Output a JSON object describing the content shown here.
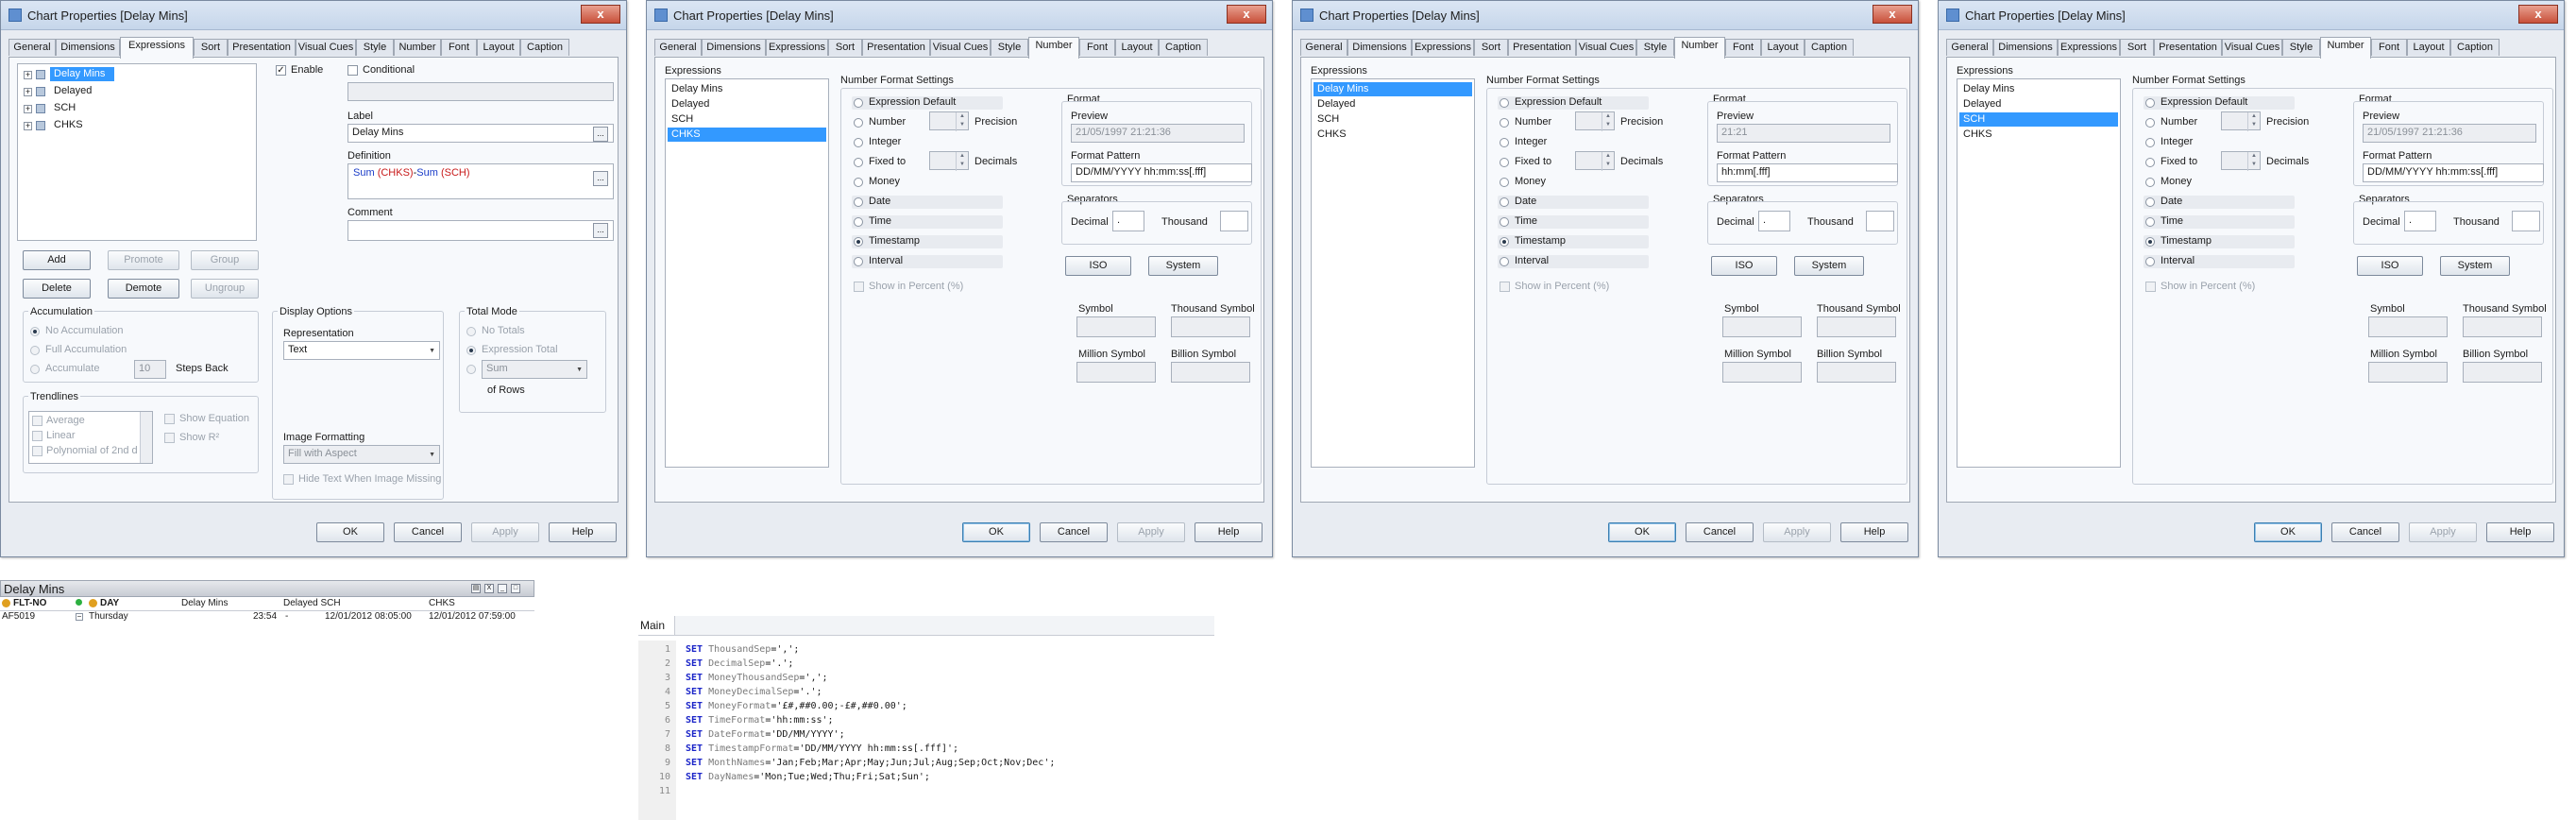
{
  "dialog_title": "Chart Properties [Delay Mins]",
  "close_glyph": "x",
  "tabs": [
    "General",
    "Dimensions",
    "Expressions",
    "Sort",
    "Presentation",
    "Visual Cues",
    "Style",
    "Number",
    "Font",
    "Layout",
    "Caption"
  ],
  "buttons": {
    "ok": "OK",
    "cancel": "Cancel",
    "apply": "Apply",
    "help": "Help"
  },
  "expressions_dialog": {
    "tree_items": [
      "Delay Mins",
      "Delayed",
      "SCH",
      "CHKS"
    ],
    "enable_label": "Enable",
    "conditional_label": "Conditional",
    "label_caption": "Label",
    "label_value": "Delay Mins",
    "definition_caption": "Definition",
    "definition_parts": {
      "f1": "Sum ",
      "a1": "(CHKS)",
      "m": "-",
      "f2": "Sum ",
      "a2": "(SCH)"
    },
    "comment_caption": "Comment",
    "btn_add": "Add",
    "btn_promote": "Promote",
    "btn_group": "Group",
    "btn_delete": "Delete",
    "btn_demote": "Demote",
    "btn_ungroup": "Ungroup",
    "accumulation": {
      "title": "Accumulation",
      "no": "No Accumulation",
      "full": "Full Accumulation",
      "acc": "Accumulate",
      "steps_value": "10",
      "steps_label": "Steps Back"
    },
    "trendlines": {
      "title": "Trendlines",
      "items": [
        "Average",
        "Linear",
        "Polynomial of 2nd d"
      ],
      "show_equation": "Show Equation",
      "show_r2": "Show R²"
    },
    "display_options": {
      "title": "Display Options",
      "representation_caption": "Representation",
      "representation_value": "Text",
      "image_caption": "Image Formatting",
      "image_value": "Fill with Aspect",
      "hide_text": "Hide Text When Image Missing"
    },
    "total_mode": {
      "title": "Total Mode",
      "no_totals": "No Totals",
      "expression_total": "Expression Total",
      "sum_value": "Sum",
      "of_rows": "of Rows"
    }
  },
  "number_dialog": {
    "expressions_caption": "Expressions",
    "items": [
      "Delay Mins",
      "Delayed",
      "SCH",
      "CHKS"
    ],
    "settings_caption": "Number Format Settings",
    "options": [
      "Expression Default",
      "Number",
      "Integer",
      "Fixed to",
      "Money",
      "Date",
      "Time",
      "Timestamp",
      "Interval"
    ],
    "precision_label": "Precision",
    "decimals_label": "Decimals",
    "show_percent": "Show in Percent (%)",
    "format_caption": "Format",
    "preview_caption": "Preview",
    "pattern_caption": "Format Pattern",
    "separators_caption": "Separators",
    "decimal_label": "Decimal",
    "thousand_label": "Thousand",
    "decimal_value": ".",
    "iso_label": "ISO",
    "system_label": "System",
    "symbol_label": "Symbol",
    "thousand_symbol_label": "Thousand Symbol",
    "million_symbol_label": "Million Symbol",
    "billion_symbol_label": "Billion Symbol",
    "dialogs": [
      {
        "selected": "CHKS",
        "preview": "21/05/1997 21:21:36",
        "pattern": "DD/MM/YYYY hh:mm:ss[.fff]"
      },
      {
        "selected": "Delay Mins",
        "preview": "21:21",
        "pattern": "hh:mm[.fff]"
      },
      {
        "selected": "SCH",
        "preview": "21/05/1997 21:21:36",
        "pattern": "DD/MM/YYYY hh:mm:ss[.fff]"
      }
    ]
  },
  "table": {
    "title": "Delay Mins",
    "headers": [
      "FLT-NO",
      "DAY",
      "Delay Mins",
      "Delayed SCH",
      "CHKS"
    ],
    "row": [
      "AF5019",
      "Thursday",
      "23:54",
      "-",
      "12/01/2012 08:05:00",
      "12/01/2012 07:59:00"
    ]
  },
  "editor": {
    "tab": "Main",
    "lines": [
      {
        "n": "1",
        "kw": "SET",
        "var": "ThousandSep",
        "val": "=',';"
      },
      {
        "n": "2",
        "kw": "SET",
        "var": "DecimalSep",
        "val": "='.';"
      },
      {
        "n": "3",
        "kw": "SET",
        "var": "MoneyThousandSep",
        "val": "=',';"
      },
      {
        "n": "4",
        "kw": "SET",
        "var": "MoneyDecimalSep",
        "val": "='.';"
      },
      {
        "n": "5",
        "kw": "SET",
        "var": "MoneyFormat",
        "val": "='£#,##0.00;-£#,##0.00';"
      },
      {
        "n": "6",
        "kw": "SET",
        "var": "TimeFormat",
        "val": "='hh:mm:ss';"
      },
      {
        "n": "7",
        "kw": "SET",
        "var": "DateFormat",
        "val": "='DD/MM/YYYY';"
      },
      {
        "n": "8",
        "kw": "SET",
        "var": "TimestampFormat",
        "val": "='DD/MM/YYYY hh:mm:ss[.fff]';"
      },
      {
        "n": "9",
        "kw": "SET",
        "var": "MonthNames",
        "val": "='Jan;Feb;Mar;Apr;May;Jun;Jul;Aug;Sep;Oct;Nov;Dec';"
      },
      {
        "n": "10",
        "kw": "SET",
        "var": "DayNames",
        "val": "='Mon;Tue;Wed;Thu;Fri;Sat;Sun';"
      },
      {
        "n": "11",
        "kw": "",
        "var": "",
        "val": ""
      }
    ]
  },
  "colors": {
    "selection": "#3399ff",
    "keyword": "#1a24c8",
    "definition_function": "#1a3cc8",
    "definition_arg": "#c81a1a"
  }
}
